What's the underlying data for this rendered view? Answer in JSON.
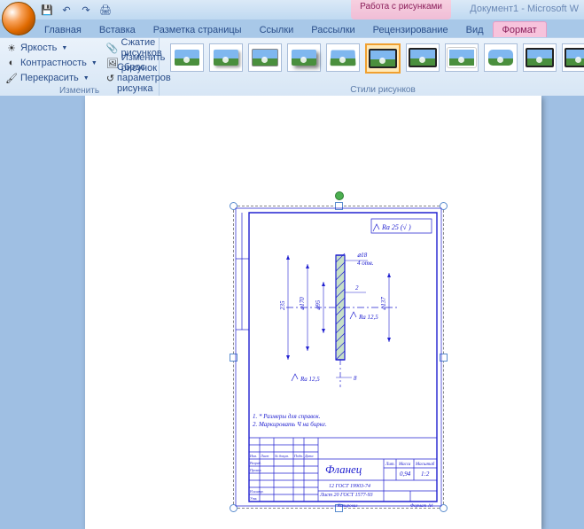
{
  "window": {
    "doc_title": "Документ1 - Microsoft W",
    "context_tab": "Работа с рисунками"
  },
  "qat": {
    "save": "💾",
    "undo": "↶",
    "redo": "↷",
    "print": "🖨"
  },
  "tabs": {
    "home": "Главная",
    "insert": "Вставка",
    "layout": "Разметка страницы",
    "links": "Ссылки",
    "mail": "Рассылки",
    "review": "Рецензирование",
    "view": "Вид",
    "format": "Формат"
  },
  "ribbon": {
    "adjust": {
      "brightness": "Яркость",
      "contrast": "Контрастность",
      "recolor": "Перекрасить",
      "compress": "Сжатие рисунков",
      "change": "Изменить рисунок",
      "reset": "Сброс параметров рисунка",
      "group": "Изменить"
    },
    "styles_group": "Стили рисунков"
  },
  "drawing": {
    "ra_top": "Ra 25 (√ )",
    "d18": "⌀18",
    "holes4": "4 отв.",
    "l235": "235",
    "d170": "⌀170",
    "d95": "⌀95",
    "d137": "⌀137",
    "dim2": "2",
    "ra125_r": "Ra 12,5",
    "ra125_b": "Ra 12,5",
    "dim8": "8",
    "note1": "1. * Размеры для справок.",
    "note2": "2. Маркировать Ч на бирке.",
    "title": "Фланец",
    "tb_mat1": "12 ГОСТ 19903-74",
    "tb_mat2": "Лист 20 ГОСТ 1577-93",
    "tb_mass": "0,94",
    "tb_scale": "1:2",
    "col_lit": "Лит.",
    "col_mass": "Масса",
    "col_scale": "Масштаб",
    "row_izm": "Изм.",
    "row_list": "Лист",
    "row_doc": "№ докум.",
    "row_sign": "Подп.",
    "row_date": "Дата",
    "row_razrab": "Разраб.",
    "row_prov": "Провер.",
    "row_ncontr": "Н.контр.",
    "row_utv": "Утв.",
    "format": "Формат",
    "a4": "А4",
    "copied": "Копировал"
  }
}
